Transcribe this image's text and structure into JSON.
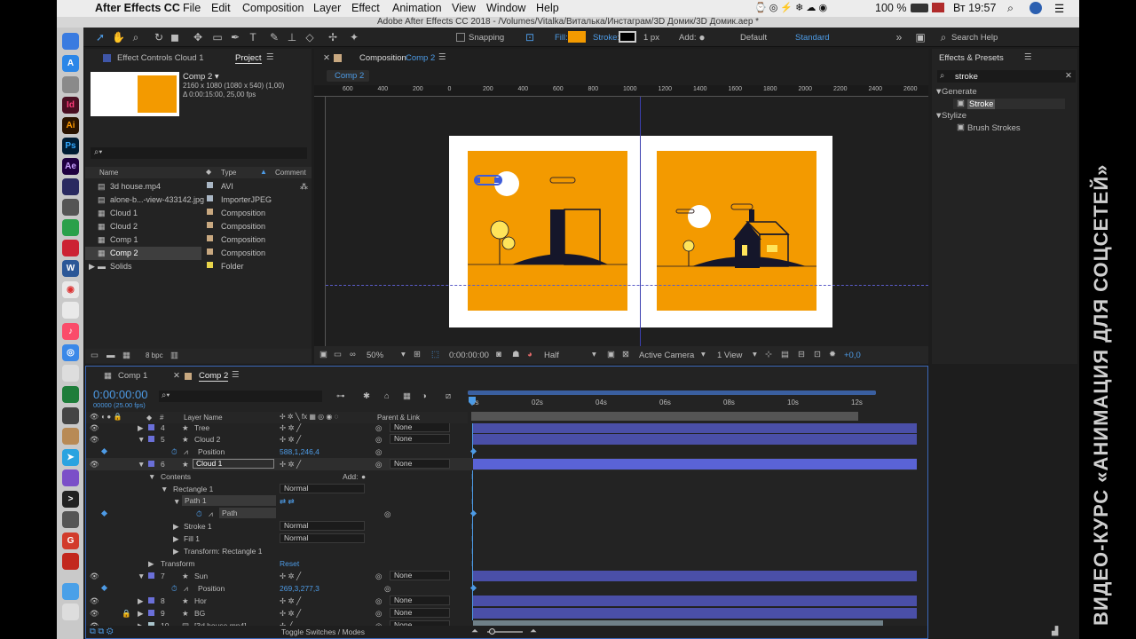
{
  "menubar": {
    "apple": "",
    "app": "After Effects CC",
    "items": [
      "File",
      "Edit",
      "Composition",
      "Layer",
      "Effect",
      "Animation",
      "View",
      "Window",
      "Help"
    ],
    "battery": "100 %",
    "time": "Вт 19:57"
  },
  "titlebar": {
    "text": "Adobe After Effects CC 2018 - /Volumes/Vitalka/Виталька/Инстаграм/3D Домик/3D Домик.aep *"
  },
  "toolbar": {
    "snapping": "Snapping",
    "fill_label": "Fill:",
    "stroke_label": "Stroke:",
    "stroke_px": "1 px",
    "add_label": "Add:",
    "ws_default": "Default",
    "ws_standard": "Standard",
    "search_help": "Search Help",
    "fill_color": "#f39a00"
  },
  "project": {
    "tab_effect_controls": "Effect Controls Cloud 1",
    "tab_project": "Project",
    "comp_name": "Comp 2 ▾",
    "comp_info1": "2160 x 1080 (1080 x 540) (1,00)",
    "comp_info2": "Δ 0:00:15:00, 25,00 fps",
    "search_placeholder": "",
    "col_name": "Name",
    "col_type": "Type",
    "col_comment": "Comment",
    "items": [
      {
        "name": "3d house.mp4",
        "type": "AVI",
        "color": "#a9b6c4"
      },
      {
        "name": "alone-b...-view-433142.jpg",
        "type": "ImporterJPEG",
        "color": "#a9b6c4"
      },
      {
        "name": "Cloud 1",
        "type": "Composition",
        "color": "#c8a880"
      },
      {
        "name": "Cloud 2",
        "type": "Composition",
        "color": "#c8a880"
      },
      {
        "name": "Comp 1",
        "type": "Composition",
        "color": "#c8a880"
      },
      {
        "name": "Comp 2",
        "type": "Composition",
        "color": "#c8a880"
      },
      {
        "name": "Solids",
        "type": "Folder",
        "color": "#e8d44a"
      }
    ],
    "bpc": "8 bpc"
  },
  "composition": {
    "tab": "Composition",
    "tab_comp": "Comp 2",
    "flow_tab": "Comp 2",
    "ruler": [
      "600",
      "400",
      "200",
      "0",
      "200",
      "400",
      "600",
      "800",
      "1000",
      "1200",
      "1400",
      "1600",
      "1800",
      "2000",
      "2200",
      "2400",
      "2600"
    ],
    "zoom": "50%",
    "timecode": "0:00:00:00",
    "resolution": "Half",
    "camera": "Active Camera",
    "view": "1 View",
    "exposure": "+0,0"
  },
  "effects": {
    "title": "Effects & Presets",
    "search": "stroke",
    "cat1": "Generate",
    "item1": "Stroke",
    "cat2": "Stylize",
    "item2": "Brush Strokes"
  },
  "timeline": {
    "tab1": "Comp 1",
    "tab2": "Comp 2",
    "timecode": "0:00:00:00",
    "frames": "00000 (25.00 fps)",
    "col_layer": "Layer Name",
    "col_parent": "Parent & Link",
    "hash": "#",
    "ticks": [
      "0s",
      "02s",
      "04s",
      "06s",
      "08s",
      "10s",
      "12s"
    ],
    "rows": [
      {
        "num": "4",
        "name": "Tree",
        "parent": "None",
        "color": "#6a6fd8"
      },
      {
        "num": "5",
        "name": "Cloud 2",
        "parent": "None",
        "color": "#6a6fd8"
      },
      {
        "name": "Position",
        "value": "588,1,246,4"
      },
      {
        "num": "6",
        "name": "Cloud 1",
        "parent": "None",
        "color": "#6a6fd8"
      },
      {
        "name": "Contents",
        "add": "Add:"
      },
      {
        "name": "Rectangle 1",
        "mode": "Normal"
      },
      {
        "name": "Path 1"
      },
      {
        "name": "Path"
      },
      {
        "name": "Stroke 1",
        "mode": "Normal"
      },
      {
        "name": "Fill 1",
        "mode": "Normal"
      },
      {
        "name": "Transform: Rectangle 1"
      },
      {
        "name": "Transform",
        "reset": "Reset"
      },
      {
        "num": "7",
        "name": "Sun",
        "parent": "None",
        "color": "#6a6fd8"
      },
      {
        "name": "Position",
        "value": "269,3,277,3"
      },
      {
        "num": "8",
        "name": "Hor",
        "parent": "None",
        "color": "#6a6fd8"
      },
      {
        "num": "9",
        "name": "BG",
        "parent": "None",
        "color": "#6a6fd8"
      },
      {
        "num": "10",
        "name": "[3d house.mp4]",
        "parent": "None",
        "color": "#a9c4cc"
      }
    ],
    "toggle": "Toggle Switches / Modes"
  },
  "watermark": "ВИДЕО-КУРС «АНИМАЦИЯ ДЛЯ СОЦСЕТЕЙ»"
}
